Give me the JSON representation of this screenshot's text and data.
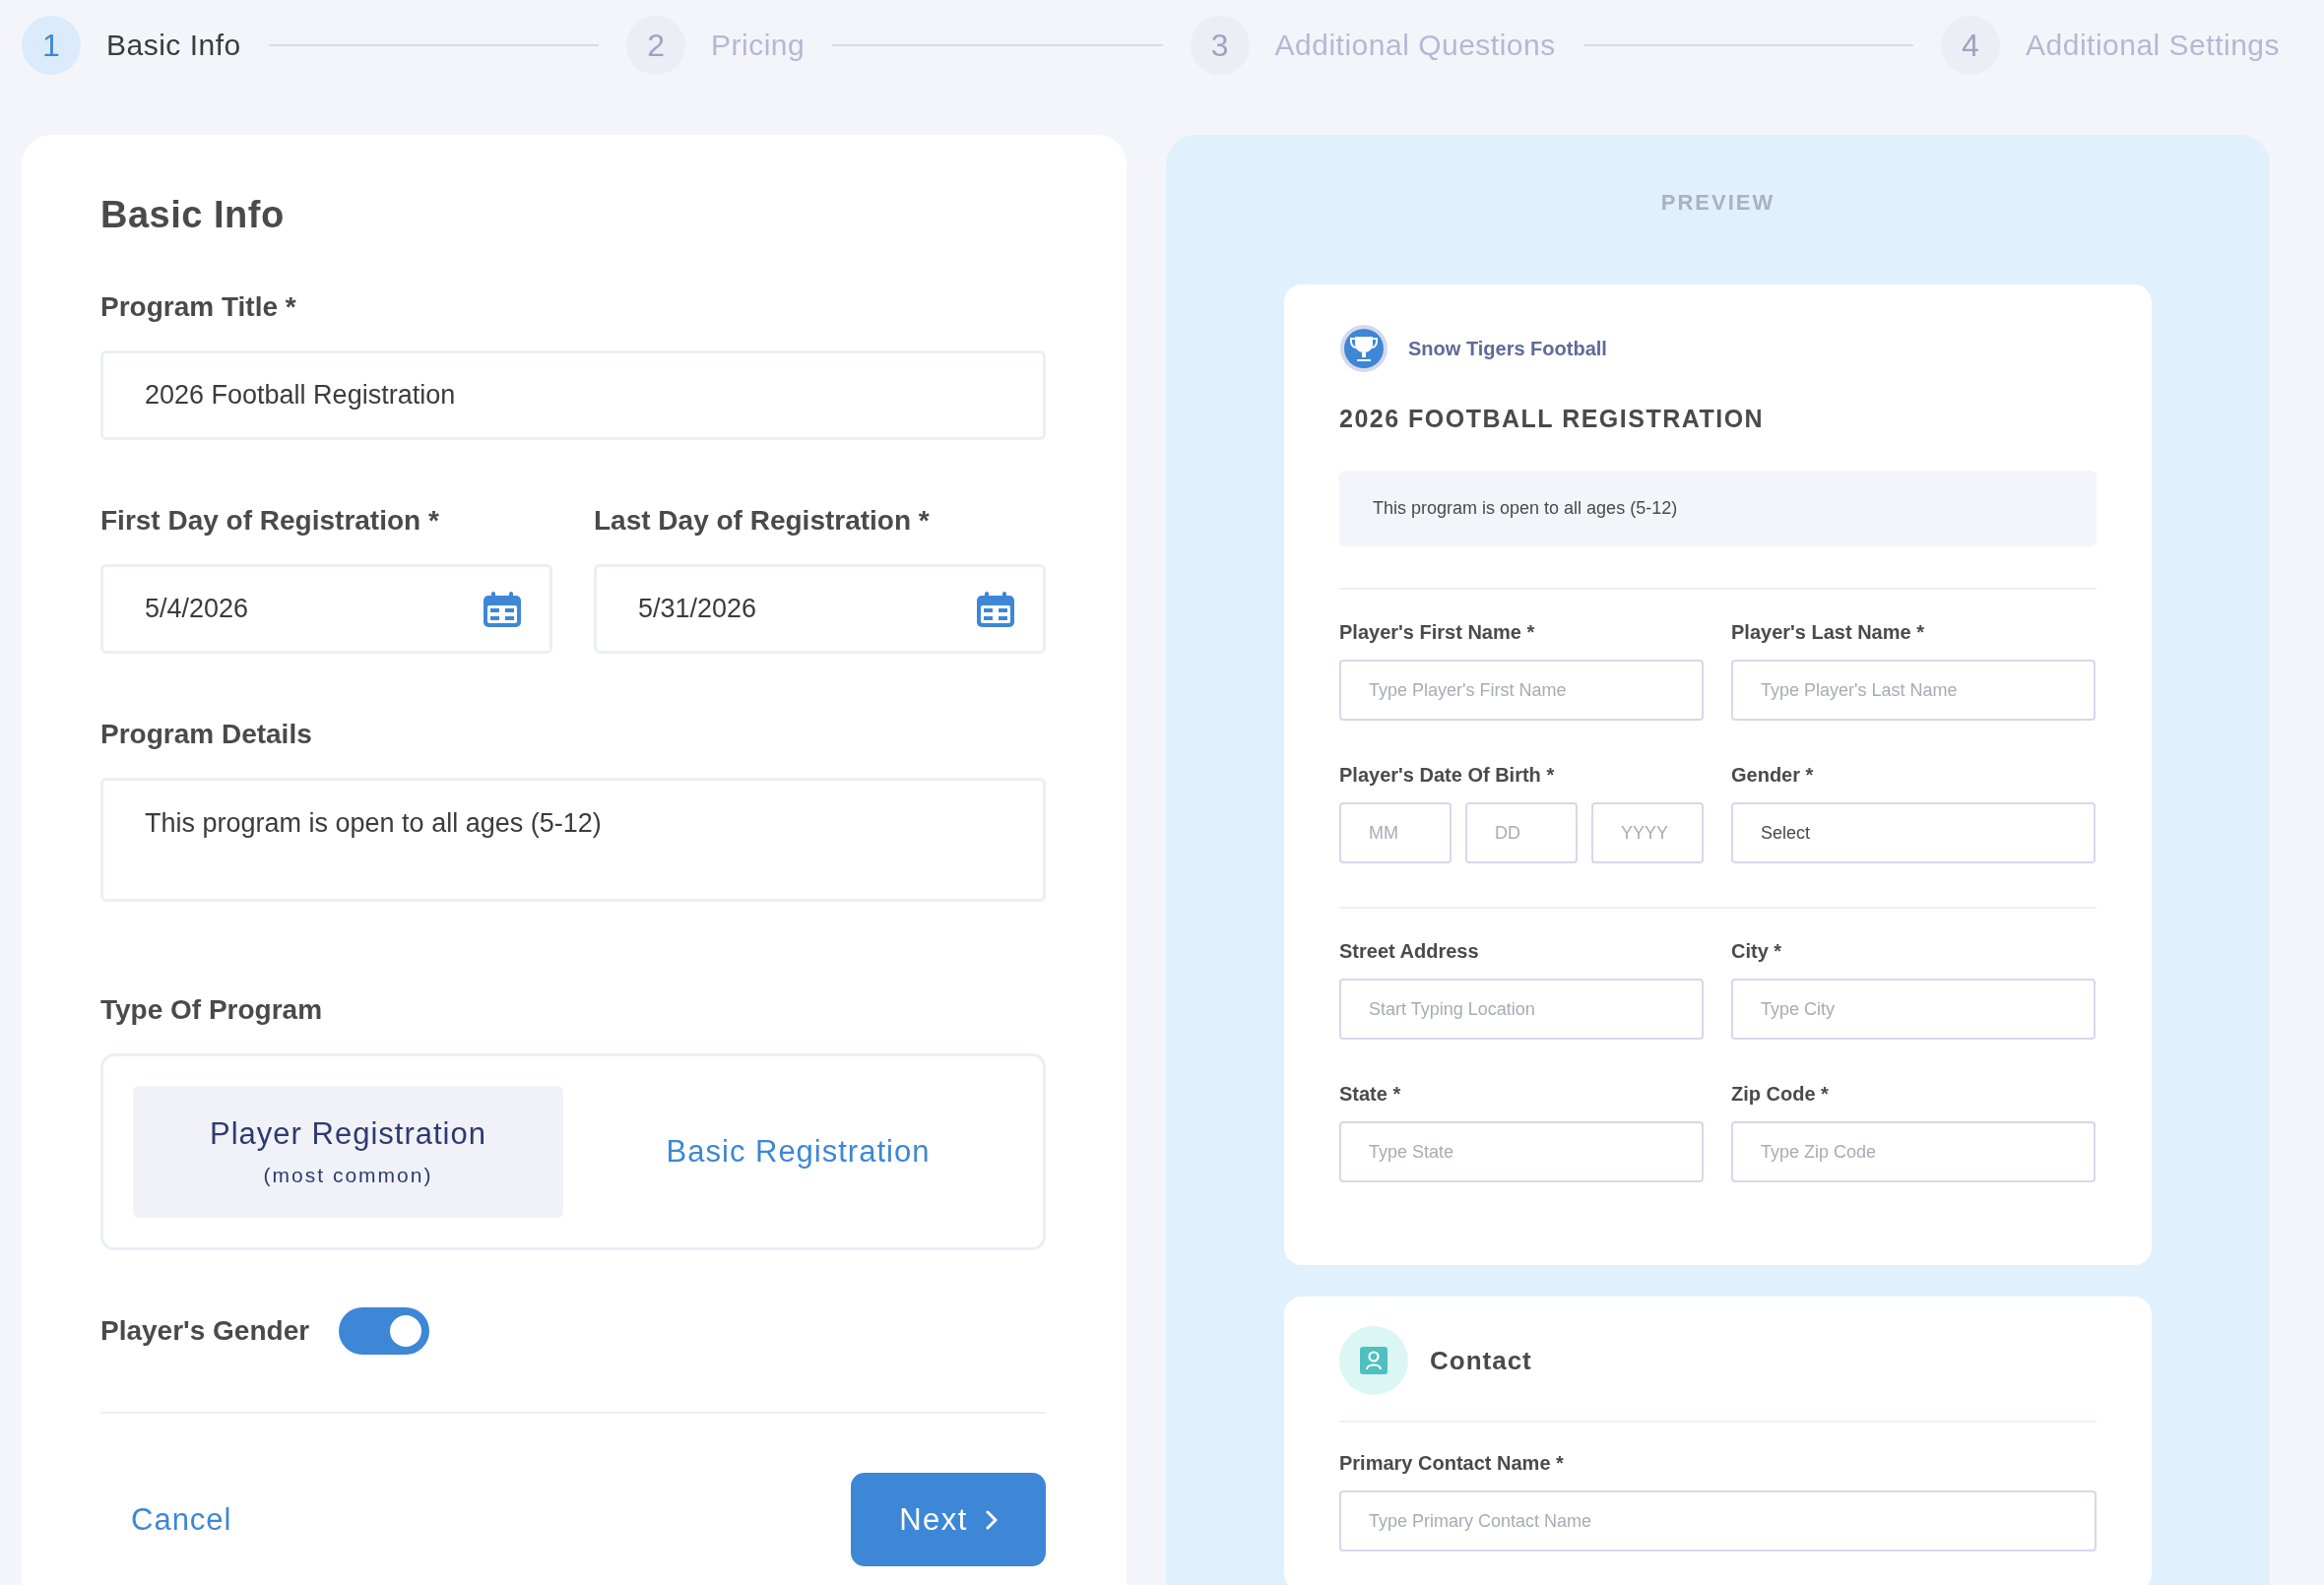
{
  "stepper": [
    {
      "number": "1",
      "label": "Basic Info",
      "selected": true
    },
    {
      "number": "2",
      "label": "Pricing",
      "selected": false
    },
    {
      "number": "3",
      "label": "Additional Questions",
      "selected": false
    },
    {
      "number": "4",
      "label": "Additional Settings",
      "selected": false
    }
  ],
  "form": {
    "title": "Basic Info",
    "program_title": {
      "label": "Program Title *",
      "value": "2026 Football Registration"
    },
    "first_day": {
      "label": "First Day of Registration *",
      "value": "5/4/2026"
    },
    "last_day": {
      "label": "Last Day of Registration *",
      "value": "5/31/2026"
    },
    "details": {
      "label": "Program Details",
      "value": "This program is open to all ages (5-12)"
    },
    "program_type": {
      "label": "Type Of Program",
      "options": [
        {
          "label": "Player Registration",
          "note": "(most common)",
          "selected": true
        },
        {
          "label": "Basic Registration",
          "selected": false
        }
      ]
    },
    "gender_toggle": {
      "label": "Player's Gender",
      "on": true
    },
    "cancel": "Cancel",
    "next": "Next"
  },
  "preview": {
    "heading": "PREVIEW",
    "org": "Snow Tigers Football",
    "title": "2026 FOOTBALL REGISTRATION",
    "description": "This program is open to all ages (5-12)",
    "groups": [
      {
        "rows": [
          [
            {
              "kind": "text",
              "label": "Player's First Name *",
              "placeholder": "Type Player's First Name"
            },
            {
              "kind": "text",
              "label": "Player's Last Name *",
              "placeholder": "Type Player's Last Name"
            }
          ],
          [
            {
              "kind": "date",
              "label": "Player's Date Of Birth *",
              "parts": [
                {
                  "placeholder": "MM"
                },
                {
                  "placeholder": "DD"
                },
                {
                  "placeholder": "YYYY"
                }
              ]
            },
            {
              "kind": "select",
              "label": "Gender *",
              "value": "Select"
            }
          ]
        ]
      },
      {
        "rows": [
          [
            {
              "kind": "text",
              "label": "Street Address",
              "placeholder": "Start Typing Location"
            },
            {
              "kind": "text",
              "label": "City *",
              "placeholder": "Type City"
            }
          ],
          [
            {
              "kind": "text",
              "label": "State *",
              "placeholder": "Type State"
            },
            {
              "kind": "text",
              "label": "Zip Code *",
              "placeholder": "Type Zip Code"
            }
          ]
        ]
      }
    ],
    "contact": {
      "title": "Contact",
      "fields": [
        {
          "kind": "text",
          "label": "Primary Contact Name *",
          "placeholder": "Type Primary Contact Name"
        }
      ]
    }
  }
}
